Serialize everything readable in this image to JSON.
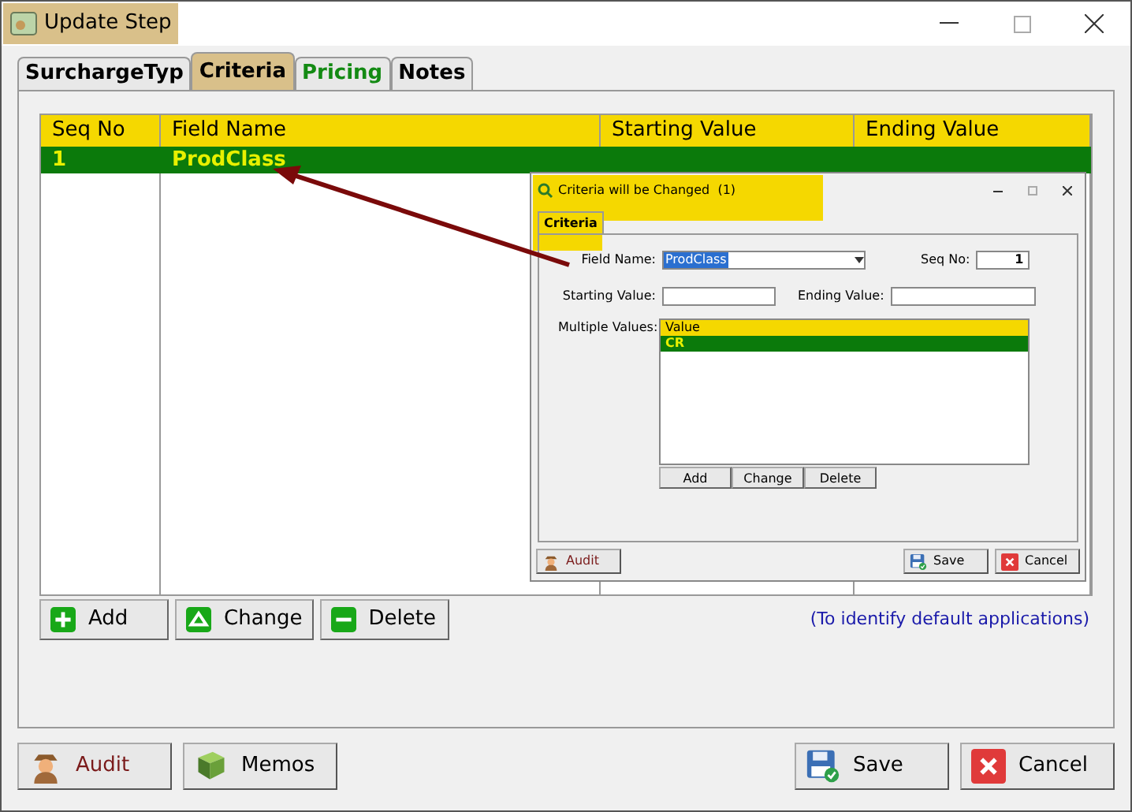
{
  "window": {
    "title": "Update Step"
  },
  "tabs": [
    {
      "label": "SurchargeTyp",
      "selected": false,
      "color": "#000000"
    },
    {
      "label": "Criteria",
      "selected": true,
      "color": "#000000"
    },
    {
      "label": "Pricing",
      "selected": false,
      "color": "#138a13"
    },
    {
      "label": "Notes",
      "selected": false,
      "color": "#000000"
    }
  ],
  "table": {
    "columns": [
      "Seq No",
      "Field Name",
      "Starting Value",
      "Ending Value"
    ],
    "rows": [
      {
        "cells": [
          "1",
          "ProdClass",
          "",
          ""
        ],
        "selected": true
      }
    ]
  },
  "grid_buttons": [
    {
      "label": "Add",
      "kind": "add"
    },
    {
      "label": "Change",
      "kind": "change"
    },
    {
      "label": "Delete",
      "kind": "delete"
    }
  ],
  "hint": "(To identify default applications)",
  "footer_buttons": [
    {
      "label": "Audit",
      "kind": "audit"
    },
    {
      "label": "Memos",
      "kind": "memos"
    },
    {
      "label": "Save",
      "kind": "save"
    },
    {
      "label": "Cancel",
      "kind": "cancel"
    }
  ],
  "inset": {
    "title": "Criteria will be Changed  (1)",
    "tab": "Criteria",
    "field_name_label": "Field Name:",
    "field_name_value": "ProdClass",
    "seq_label": "Seq No:",
    "seq_value": "1",
    "start_label": "Starting Value:",
    "end_label": "Ending Value:",
    "multi_label": "Multiple Values:",
    "list_header": "Value",
    "list_rows": [
      {
        "label": "CR",
        "selected": true
      }
    ],
    "list_buttons": [
      "Add",
      "Change",
      "Delete"
    ],
    "buttons": [
      {
        "label": "Audit",
        "kind": "audit"
      },
      {
        "label": "Save",
        "kind": "save"
      },
      {
        "label": "Cancel",
        "kind": "cancel"
      }
    ]
  }
}
